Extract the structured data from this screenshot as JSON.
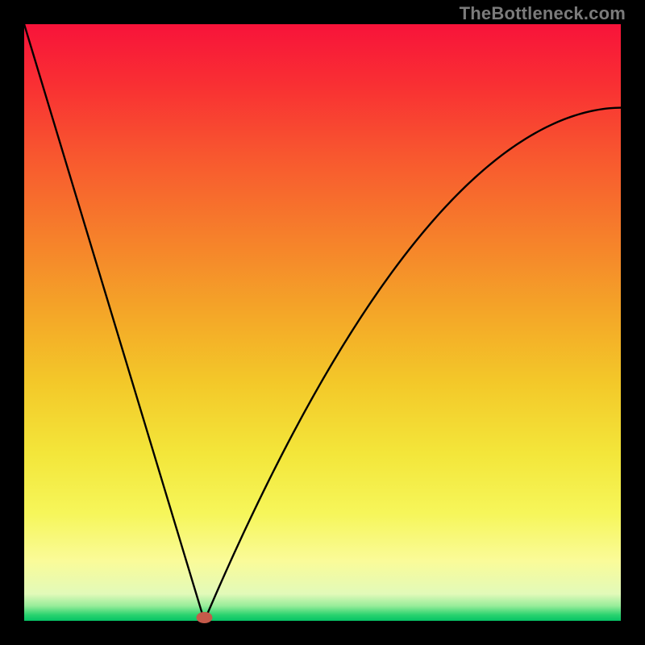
{
  "watermark": "TheBottleneck.com",
  "plot": {
    "inner_x": 30,
    "inner_y": 30,
    "inner_w": 740,
    "inner_h": 740
  },
  "gradient": {
    "stops": [
      {
        "offset": 0.0,
        "color": "#f8133a"
      },
      {
        "offset": 0.1,
        "color": "#f92f33"
      },
      {
        "offset": 0.22,
        "color": "#f8572f"
      },
      {
        "offset": 0.35,
        "color": "#f67e2b"
      },
      {
        "offset": 0.48,
        "color": "#f4a528"
      },
      {
        "offset": 0.6,
        "color": "#f3c829"
      },
      {
        "offset": 0.72,
        "color": "#f3e63a"
      },
      {
        "offset": 0.82,
        "color": "#f6f65a"
      },
      {
        "offset": 0.9,
        "color": "#fafb99"
      },
      {
        "offset": 0.955,
        "color": "#e2fab9"
      },
      {
        "offset": 0.975,
        "color": "#97ec9a"
      },
      {
        "offset": 0.99,
        "color": "#2bd36f"
      },
      {
        "offset": 1.0,
        "color": "#06c365"
      }
    ]
  },
  "marker": {
    "x_norm": 0.302,
    "color": "#c55a4a",
    "rx": 10,
    "ry": 7
  },
  "chart_data": {
    "type": "line",
    "title": "",
    "xlabel": "",
    "ylabel": "",
    "xlim": [
      0,
      1
    ],
    "ylim": [
      0,
      1
    ],
    "x_star": 0.302,
    "series": [
      {
        "name": "curve",
        "x": [
          0.0,
          0.05,
          0.1,
          0.15,
          0.2,
          0.25,
          0.28,
          0.302,
          0.33,
          0.37,
          0.42,
          0.48,
          0.55,
          0.63,
          0.72,
          0.82,
          0.91,
          1.0
        ],
        "y": [
          1.0,
          0.834,
          0.669,
          0.503,
          0.338,
          0.172,
          0.073,
          0.0,
          0.12,
          0.26,
          0.4,
          0.52,
          0.62,
          0.7,
          0.76,
          0.81,
          0.84,
          0.86
        ]
      }
    ],
    "annotations": []
  }
}
